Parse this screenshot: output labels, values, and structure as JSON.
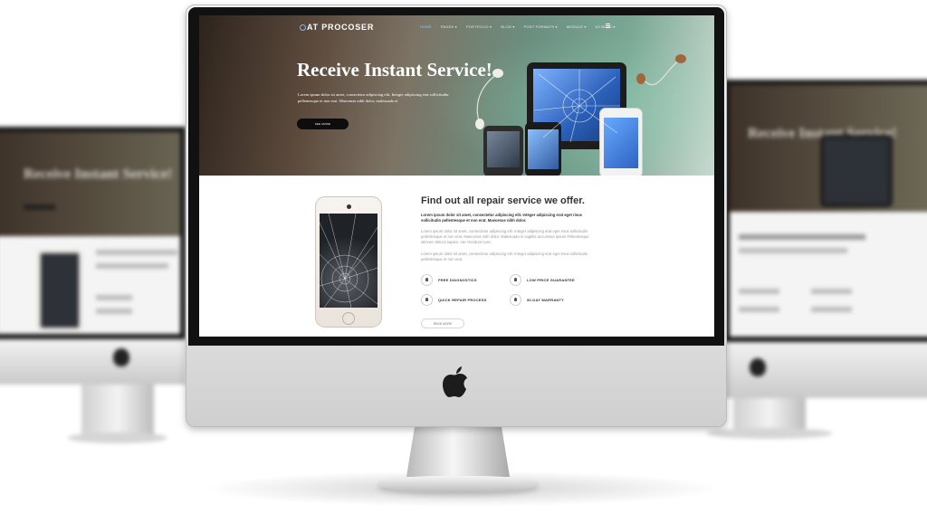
{
  "site": {
    "brand": "AT PROCOSER",
    "nav": [
      {
        "label": "HOME",
        "active": true
      },
      {
        "label": "PAGES ▾"
      },
      {
        "label": "PORTFOLIO ▾"
      },
      {
        "label": "BLOG ▾"
      },
      {
        "label": "POST FORMATS ▾"
      },
      {
        "label": "MODULE ▾"
      },
      {
        "label": "K2 BLOG ▾"
      }
    ]
  },
  "hero": {
    "title": "Receive Instant Service!",
    "text": "Lorem ipsum dolor sit amet, consectetur adipiscing elit. Integer adipiscing erat sollicitudin pellentesque et non erat. Maecenas nibh dolor, malesuada et",
    "button": "SEE MORE"
  },
  "section": {
    "title": "Find out all repair service we offer.",
    "lead": "Lorem ipsum dolor sit amet, consectetur adipiscing elit. Integer adipiscing erat eget risus sollicitudin pellentesque et non erat. Maecenas nibh dolor.",
    "paragraph1": "Lorem ipsum dolor sit amet, consectetur adipiscing elit. Integer adipiscing erat eget risus sollicitudin pellentesque et non erat. Maecenas nibh dolor. Malesuada et sagittis accumsan ipsum Pellentesque ultrices ultrices sapien, nec tincidunt nunc.",
    "paragraph2": "Lorem ipsum dolor sit amet, consectetur adipiscing elit. Integer adipiscing erat eget risus sollicitudin pellentesque et non erat.",
    "features": [
      "FREE DIAGNOSTICS",
      "LOW PRICE GUARANTEE",
      "QUICK REPAIR PROCESS",
      "90-DAY WARRANTY"
    ],
    "read_more": "READ MORE"
  },
  "background": {
    "hero_title": "Receive Instant Service!"
  },
  "colors": {
    "accent_link": "#7fd0ff",
    "button_dark": "#0d0d0d",
    "monitor_bezel": "#111111"
  }
}
